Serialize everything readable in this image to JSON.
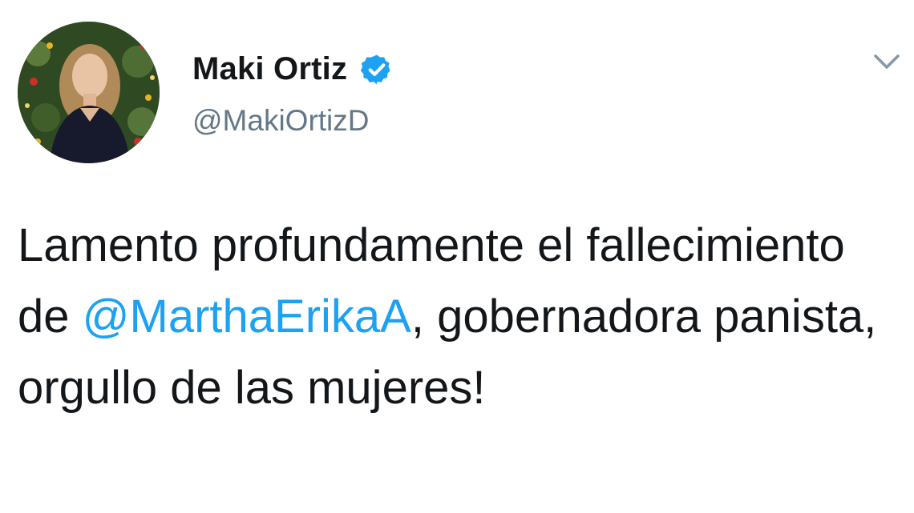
{
  "author": {
    "display_name": "Maki Ortiz",
    "handle": "@MakiOrtizD",
    "verified": true
  },
  "tweet": {
    "text_part1": "Lamento profundamente el fallecimiento de ",
    "mention": "@MarthaErikaA",
    "text_part2": ", gobernadora panista, orgullo de las mujeres!"
  },
  "icons": {
    "verified": "verified-badge-icon",
    "more": "chevron-down-icon"
  },
  "colors": {
    "text": "#14171a",
    "secondary_text": "#657786",
    "link": "#1da1f2",
    "verified_badge": "#1da1f2",
    "background": "#ffffff"
  }
}
